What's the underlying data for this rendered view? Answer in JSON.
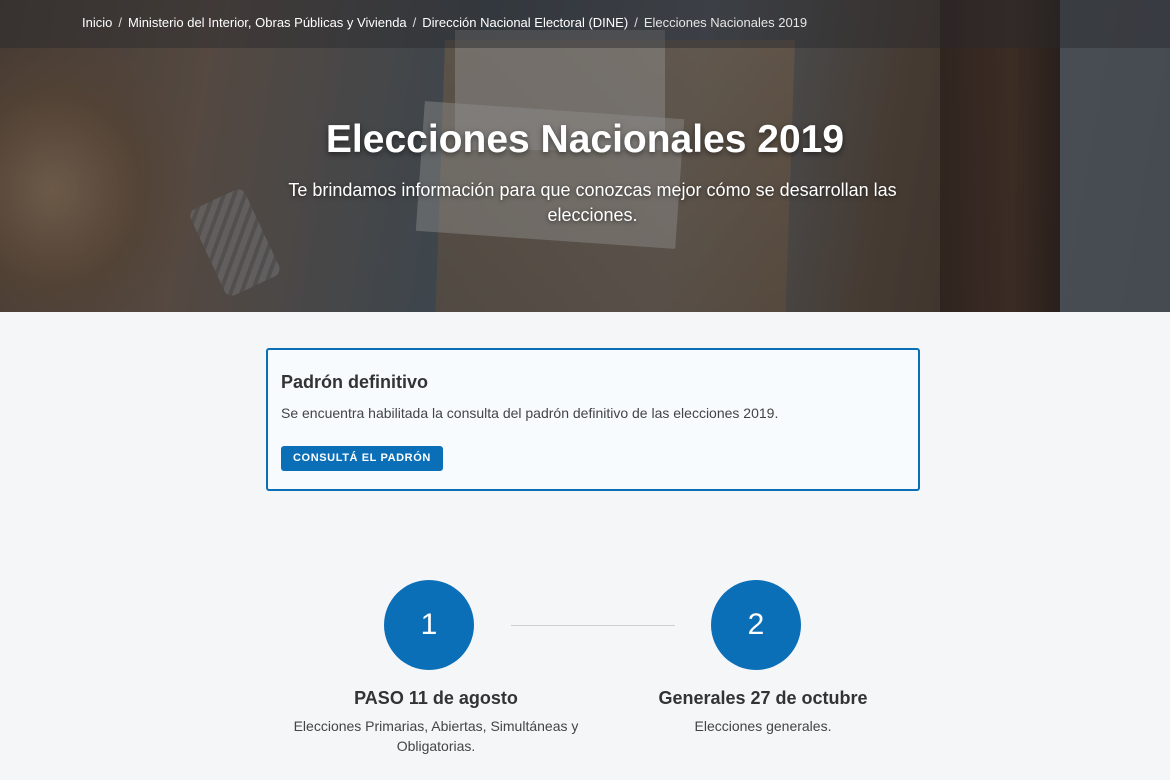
{
  "breadcrumb": {
    "items": [
      {
        "label": "Inicio"
      },
      {
        "label": "Ministerio del Interior, Obras Públicas y Vivienda"
      },
      {
        "label": "Dirección Nacional Electoral (DINE)"
      }
    ],
    "current": "Elecciones Nacionales 2019",
    "separator": "/"
  },
  "hero": {
    "title": "Elecciones Nacionales 2019",
    "subtitle": "Te brindamos información para que conozcas mejor cómo se desarrollan las elecciones."
  },
  "card": {
    "title": "Padrón definitivo",
    "text": "Se encuentra habilitada la consulta del padrón definitivo de las elecciones 2019.",
    "button_label": "CONSULTÁ EL PADRÓN"
  },
  "steps": [
    {
      "number": "1",
      "title": "PASO 11 de agosto",
      "description": "Elecciones Primarias, Abiertas, Simultáneas y Obligatorias."
    },
    {
      "number": "2",
      "title": "Generales 27 de octubre",
      "description": "Elecciones generales."
    }
  ],
  "colors": {
    "accent": "#0b6fb8",
    "background": "#f5f6f8",
    "card_background": "#f7fbfd",
    "text": "#333333"
  }
}
